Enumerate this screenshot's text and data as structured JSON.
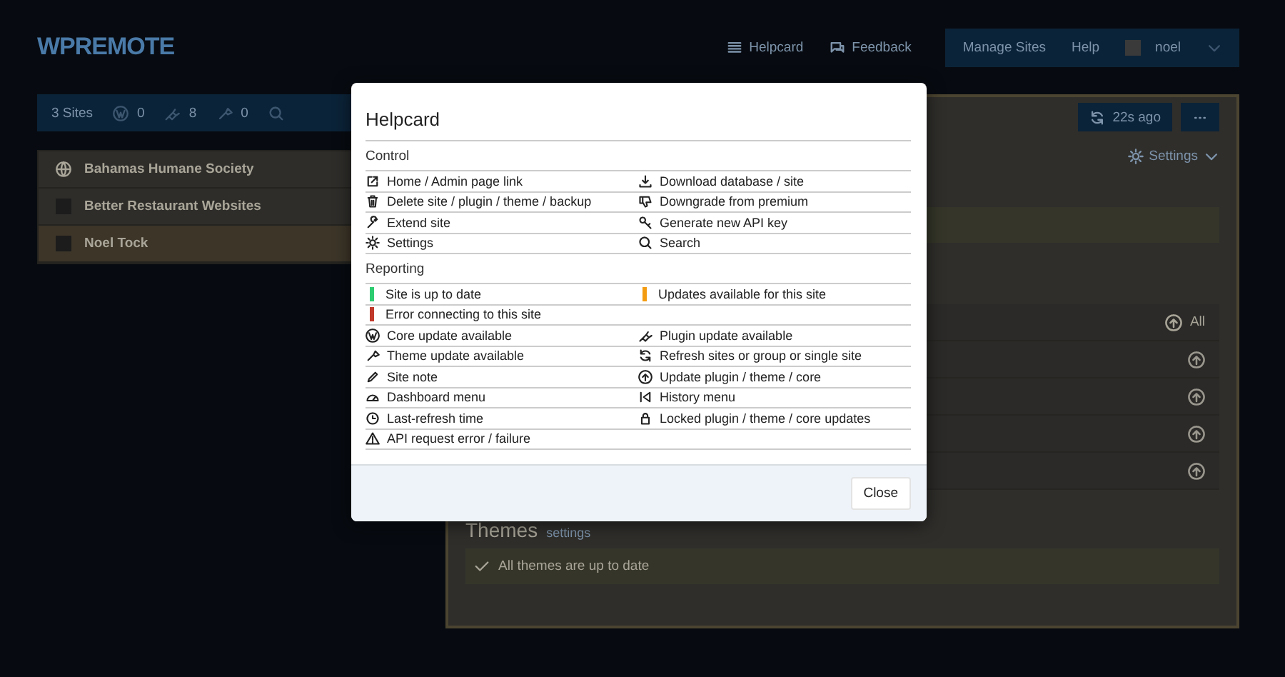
{
  "header": {
    "logo": "WPREMOTE",
    "links": [
      {
        "kind": "helpcard",
        "label": "Helpcard"
      },
      {
        "kind": "feedback",
        "label": "Feedback"
      }
    ],
    "menu": [
      "Manage Sites",
      "Help"
    ],
    "user": "noel"
  },
  "toolbar": {
    "sites": "3 Sites",
    "counts": [
      {
        "kind": "core",
        "count": "0"
      },
      {
        "kind": "plugin",
        "count": "8"
      },
      {
        "kind": "theme",
        "count": "0"
      }
    ]
  },
  "sites": [
    {
      "kind": "globe",
      "name": "Bahamas Humane Society",
      "selected": false
    },
    {
      "kind": "favicon",
      "name": "Better Restaurant Websites",
      "selected": false
    },
    {
      "kind": "favicon",
      "name": "Noel Tock",
      "selected": true
    }
  ],
  "panel": {
    "refresh": "22s ago",
    "settings": "Settings",
    "update_all": "All",
    "themes": {
      "title": "Themes",
      "link": "settings",
      "status": "All themes are up to date"
    }
  },
  "modal": {
    "title": "Helpcard",
    "sections": [
      {
        "heading": "Control",
        "rows": [
          [
            {
              "kind": "link",
              "label": "Home / Admin page link"
            },
            {
              "kind": "download",
              "label": "Download database / site"
            }
          ],
          [
            {
              "kind": "delete",
              "label": "Delete site / plugin / theme / backup"
            },
            {
              "kind": "downgrade",
              "label": "Downgrade from premium"
            }
          ],
          [
            {
              "kind": "extend",
              "label": "Extend site"
            },
            {
              "kind": "apikey",
              "label": "Generate new API key"
            }
          ],
          [
            {
              "kind": "settings",
              "label": "Settings"
            },
            {
              "kind": "search",
              "label": "Search"
            }
          ]
        ]
      },
      {
        "heading": "Reporting",
        "rows": [
          [
            {
              "kind": "status",
              "color": "#2ecc71",
              "label": "Site is up to date"
            },
            {
              "kind": "status",
              "color": "#f39c12",
              "label": "Updates available for this site"
            }
          ],
          [
            {
              "kind": "status",
              "color": "#c0392b",
              "label": "Error connecting to this site"
            }
          ],
          [
            {
              "kind": "core",
              "label": "Core update available"
            },
            {
              "kind": "plugin",
              "label": "Plugin update available"
            }
          ],
          [
            {
              "kind": "theme",
              "label": "Theme update available"
            },
            {
              "kind": "refresh",
              "label": "Refresh sites or group or single site"
            }
          ],
          [
            {
              "kind": "note",
              "label": "Site note"
            },
            {
              "kind": "update",
              "label": "Update plugin / theme / core"
            }
          ],
          [
            {
              "kind": "dashboard",
              "label": "Dashboard menu"
            },
            {
              "kind": "history",
              "label": "History menu"
            }
          ],
          [
            {
              "kind": "lastrefresh",
              "label": "Last-refresh time"
            },
            {
              "kind": "locked",
              "label": "Locked plugin / theme / core updates"
            }
          ],
          [
            {
              "kind": "error",
              "label": "API request error / failure"
            }
          ]
        ]
      }
    ],
    "close": "Close"
  }
}
